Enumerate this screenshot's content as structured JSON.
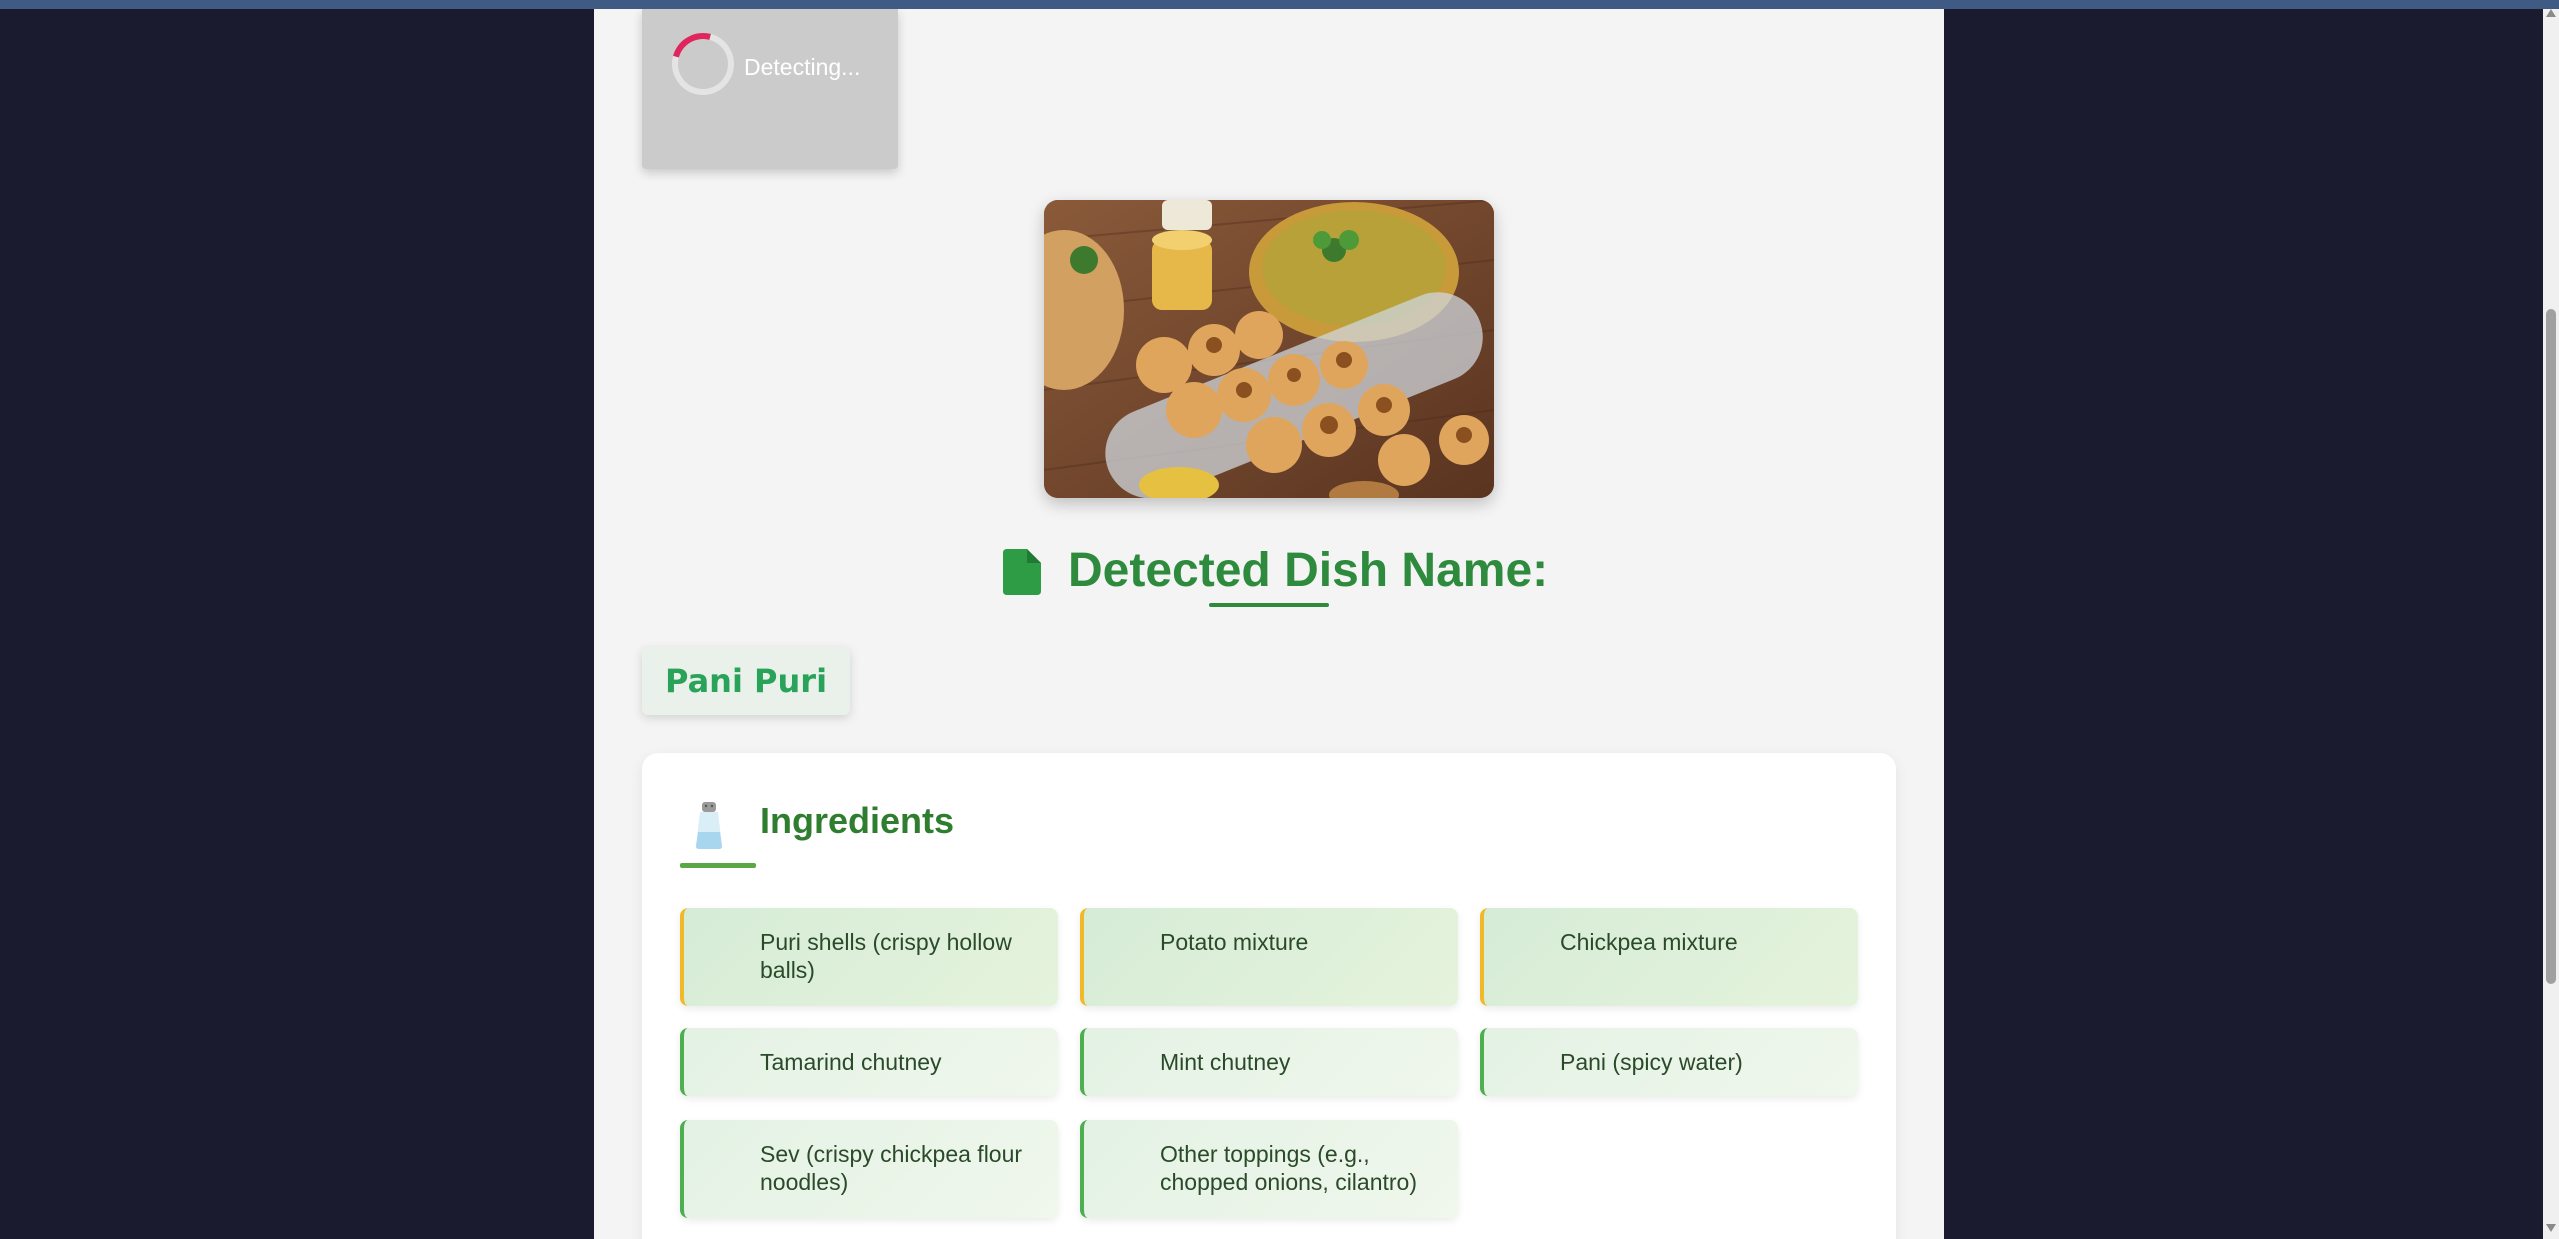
{
  "detect_button": {
    "label": "Detecting..."
  },
  "heading": {
    "text": "Detected Dish Name:"
  },
  "dish": {
    "name": "Pani Puri"
  },
  "ingredients": {
    "title": "Ingredients",
    "items": [
      "Puri shells (crispy hollow balls)",
      "Potato mixture",
      "Chickpea mixture",
      "Tamarind chutney",
      "Mint chutney",
      "Pani (spicy water)",
      "Sev (crispy chickpea flour noodles)",
      "Other toppings (e.g., chopped onions, cilantro)"
    ]
  },
  "colors": {
    "accent": "#2e8b3e",
    "dish_name": "#2aa35a",
    "spinner": "#e0245e",
    "highlight_border": "#f0b92a",
    "normal_border": "#4caf50"
  },
  "icons": {
    "heading": "document-icon",
    "ingredients": "salt-shaker-icon"
  }
}
